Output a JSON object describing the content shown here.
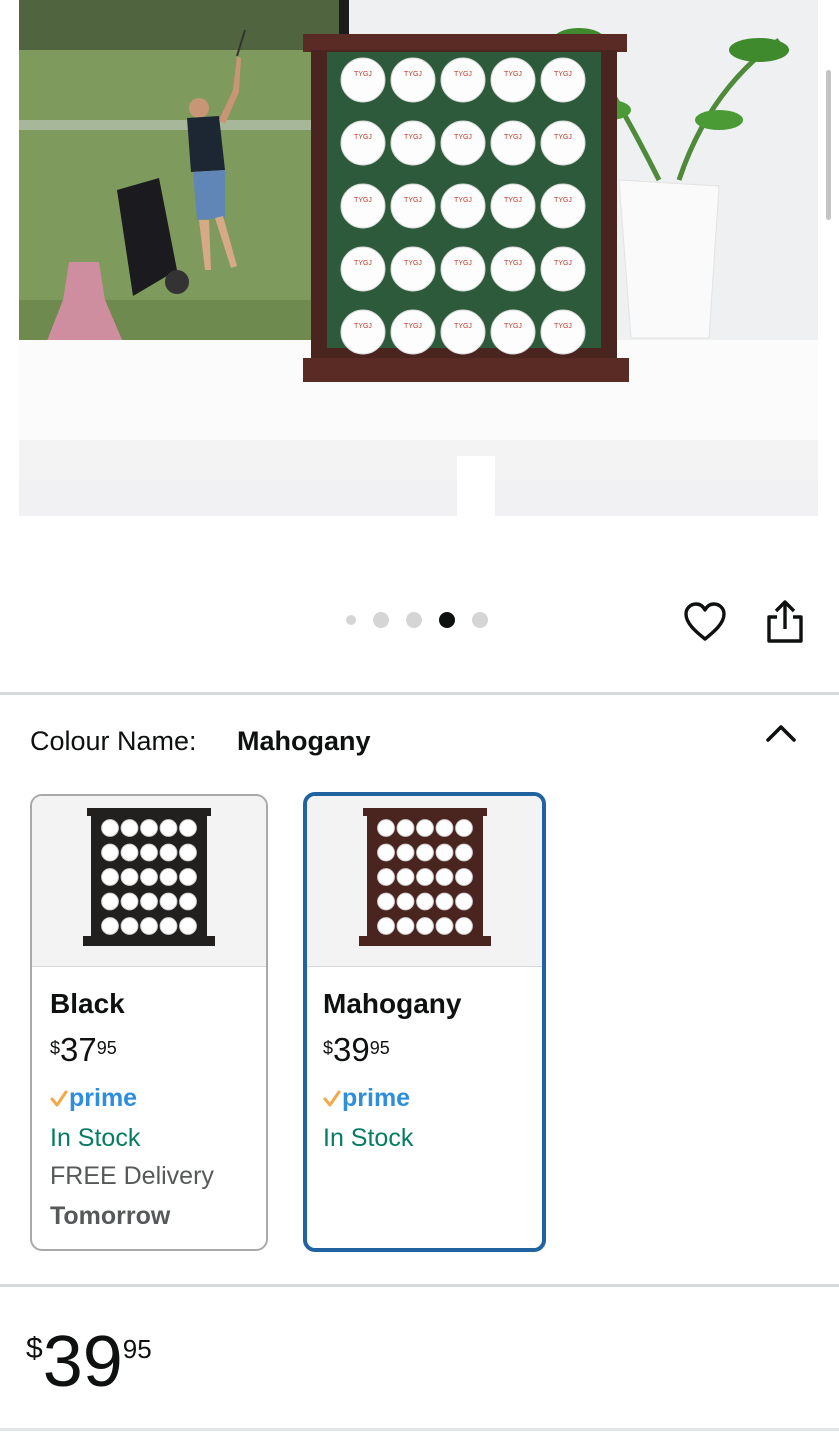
{
  "gallery": {
    "image_icon": "golf-ball-display-case-photo",
    "dot_count": 5,
    "active_dot_index": 3,
    "wishlist_icon": "heart-icon",
    "share_icon": "share-icon",
    "ball_brand": "TYGJ"
  },
  "variation": {
    "label": "Colour Name:",
    "selected_value": "Mahogany",
    "collapse_icon": "chevron-up-icon",
    "options": [
      {
        "name": "Black",
        "price_symbol": "$",
        "price_whole": "37",
        "price_fraction": "95",
        "prime_label": "prime",
        "stock": "In Stock",
        "delivery": "FREE Delivery",
        "delivery_when": "Tomorrow",
        "frame_color": "#22201f"
      },
      {
        "name": "Mahogany",
        "price_symbol": "$",
        "price_whole": "39",
        "price_fraction": "95",
        "prime_label": "prime",
        "stock": "In Stock",
        "frame_color": "#4a2520"
      }
    ]
  },
  "price": {
    "symbol": "$",
    "whole": "39",
    "fraction": "95"
  },
  "colors": {
    "selected_border": "#2162a1",
    "in_stock": "#067d62",
    "prime_blue": "#2d8ede",
    "prime_check": "#f3a847"
  }
}
